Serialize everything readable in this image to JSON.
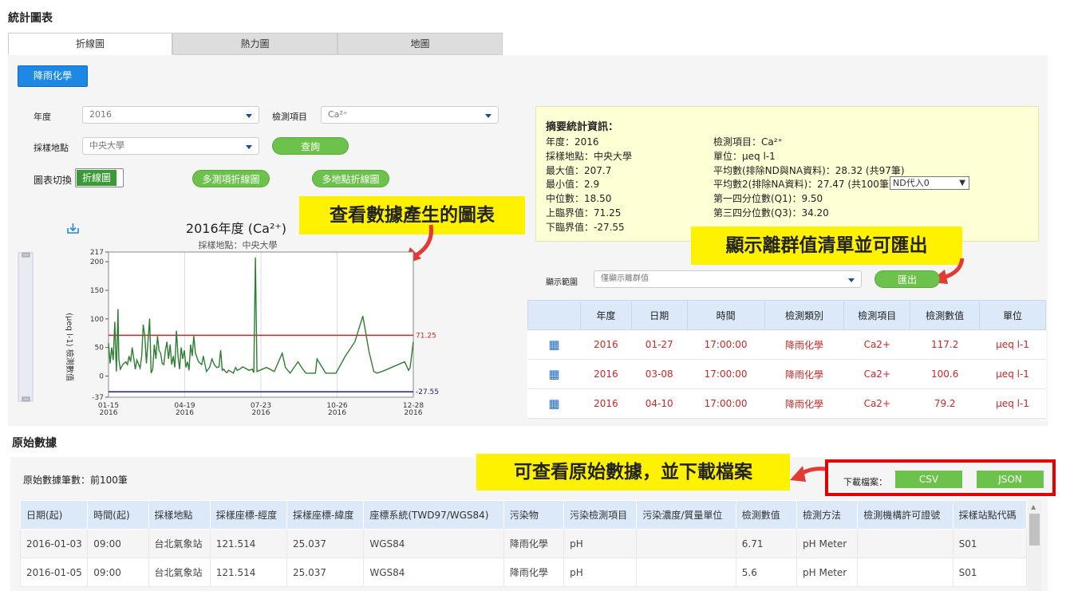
{
  "page_title": "統計圖表",
  "tabs": [
    "折線圖",
    "熱力圖",
    "地圖"
  ],
  "category_button": "降雨化學",
  "filters": {
    "year_label": "年度",
    "year_value": "2016",
    "item_label": "檢測項目",
    "item_value": "Ca²⁺",
    "site_label": "採樣地點",
    "site_value": "中央大學",
    "query_button": "查詢",
    "switch_label": "圖表切換",
    "switch_value": "折線圖",
    "multi_item_button": "多測項折線圖",
    "multi_site_button": "多地點折線圖"
  },
  "callouts": {
    "chart": "查看數據產生的圖表",
    "outlier": "顯示離群值清單並可匯出",
    "raw": "可查看原始數據，並下載檔案"
  },
  "chart_data": {
    "type": "line",
    "title": "2016年度 (Ca²⁺)",
    "subtitle": "採樣地點：中央大學",
    "ylabel": "(μeq l-1) 檢測數值",
    "ylim": [
      -37,
      217
    ],
    "yticks": [
      "217",
      "200",
      "150",
      "100",
      "50",
      "0",
      "-37"
    ],
    "xticks": [
      {
        "d": "01-15",
        "y": "2016"
      },
      {
        "d": "04-19",
        "y": "2016"
      },
      {
        "d": "07-23",
        "y": "2016"
      },
      {
        "d": "10-26",
        "y": "2016"
      },
      {
        "d": "12-28",
        "y": "2016"
      }
    ],
    "upper_bound": 71.25,
    "lower_bound": -27.55,
    "upper_label": "71.25",
    "lower_label": "-27.55",
    "series": [
      {
        "values": [
          [
            0,
            58
          ],
          [
            2,
            22
          ],
          [
            4,
            50
          ],
          [
            6,
            28
          ],
          [
            8,
            95
          ],
          [
            9,
            45
          ],
          [
            10,
            8
          ],
          [
            12,
            117.2
          ],
          [
            13,
            30
          ],
          [
            15,
            12
          ],
          [
            18,
            20
          ],
          [
            22,
            25
          ],
          [
            24,
            20
          ],
          [
            26,
            35
          ],
          [
            28,
            25
          ],
          [
            30,
            50
          ],
          [
            34,
            12
          ],
          [
            36,
            28
          ],
          [
            40,
            14
          ],
          [
            42,
            35
          ],
          [
            44,
            90
          ],
          [
            46,
            70
          ],
          [
            48,
            22
          ],
          [
            52,
            100.6
          ],
          [
            54,
            5
          ],
          [
            56,
            12
          ],
          [
            58,
            55
          ],
          [
            60,
            30
          ],
          [
            62,
            70
          ],
          [
            64,
            45
          ],
          [
            66,
            40
          ],
          [
            68,
            22
          ],
          [
            70,
            20
          ],
          [
            72,
            45
          ],
          [
            74,
            60
          ],
          [
            76,
            30
          ],
          [
            78,
            55
          ],
          [
            80,
            20
          ],
          [
            82,
            35
          ],
          [
            84,
            15
          ],
          [
            86,
            79.2
          ],
          [
            88,
            35
          ],
          [
            90,
            12
          ],
          [
            92,
            50
          ],
          [
            94,
            30
          ],
          [
            96,
            45
          ],
          [
            98,
            15
          ],
          [
            100,
            25
          ],
          [
            102,
            10
          ],
          [
            104,
            55
          ],
          [
            106,
            35
          ],
          [
            108,
            70
          ],
          [
            110,
            40
          ],
          [
            114,
            25
          ],
          [
            118,
            20
          ],
          [
            120,
            35
          ],
          [
            124,
            8
          ],
          [
            128,
            15
          ],
          [
            131,
            30
          ],
          [
            134,
            20
          ],
          [
            137,
            15
          ],
          [
            140,
            16
          ],
          [
            142,
            45
          ],
          [
            143,
            30
          ],
          [
            144,
            10
          ],
          [
            146,
            12
          ],
          [
            148,
            8
          ],
          [
            150,
            6
          ],
          [
            152,
            10
          ],
          [
            155,
            8
          ],
          [
            158,
            5
          ],
          [
            161,
            15
          ],
          [
            163,
            10
          ],
          [
            166,
            12
          ],
          [
            170,
            16
          ],
          [
            178,
            10
          ],
          [
            182,
            12
          ],
          [
            184,
            6
          ],
          [
            186,
            207.7
          ],
          [
            188,
            8
          ],
          [
            200,
            15
          ],
          [
            210,
            8
          ],
          [
            220,
            40
          ],
          [
            224,
            15
          ],
          [
            230,
            5
          ],
          [
            240,
            25
          ],
          [
            246,
            12
          ],
          [
            250,
            5
          ],
          [
            262,
            5
          ],
          [
            264,
            30
          ],
          [
            275,
            5
          ],
          [
            288,
            5
          ],
          [
            300,
            35
          ],
          [
            312,
            60
          ],
          [
            322,
            105
          ],
          [
            330,
            42
          ],
          [
            336,
            8
          ],
          [
            340,
            5
          ],
          [
            350,
            10
          ],
          [
            370,
            22
          ],
          [
            375,
            25
          ],
          [
            380,
            10
          ],
          [
            382,
            15
          ],
          [
            386,
            60
          ]
        ]
      }
    ],
    "x_range": [
      0,
      386
    ]
  },
  "summary": {
    "title": "摘要統計資訊：",
    "left": [
      "年度：2016",
      "採樣地點：中央大學",
      "最大值：207.7",
      "最小值：2.9",
      "中位數：18.50",
      "上臨界值：71.25",
      "下臨界值：-27.55"
    ],
    "right": [
      "檢測項目：Ca²⁺",
      "單位：μeq l-1",
      "平均數(排除ND與NA資料)：28.32 (共97筆)",
      "平均數2(排除NA資料)：27.47 (共100筆)",
      "第一四分位數(Q1)：9.50",
      "第三四分位數(Q3)：34.20"
    ],
    "nd_select": "ND代入0"
  },
  "outlier": {
    "range_label": "顯示範圍",
    "range_value": "僅顯示離群值",
    "export_button": "匯出",
    "headers": [
      "",
      "年度",
      "日期",
      "時間",
      "檢測類別",
      "檢測項目",
      "檢測數值",
      "單位"
    ],
    "rows": [
      [
        "2016",
        "01-27",
        "17:00:00",
        "降雨化學",
        "Ca2+",
        "117.2",
        "μeq l-1"
      ],
      [
        "2016",
        "03-08",
        "17:00:00",
        "降雨化學",
        "Ca2+",
        "100.6",
        "μeq l-1"
      ],
      [
        "2016",
        "04-10",
        "17:00:00",
        "降雨化學",
        "Ca2+",
        "79.2",
        "μeq l-1"
      ]
    ]
  },
  "raw": {
    "section_title": "原始數據",
    "count_label": "原始數據筆數：前100筆",
    "download_label": "下載檔案：",
    "csv_button": "CSV",
    "json_button": "JSON",
    "headers": [
      "日期(起)",
      "時間(起)",
      "採樣地點",
      "採樣座標-經度",
      "採樣座標-緯度",
      "座標系統(TWD97/WGS84)",
      "污染物",
      "污染檢測項目",
      "污染濃度/質量單位",
      "檢測數值",
      "檢測方法",
      "檢測機構許可證號",
      "採樣站點代碼"
    ],
    "rows": [
      [
        "2016-01-03",
        "09:00",
        "台北氣象站",
        "121.514",
        "25.037",
        "WGS84",
        "降雨化學",
        "pH",
        "",
        "6.71",
        "pH Meter",
        "",
        "S01"
      ],
      [
        "2016-01-05",
        "09:00",
        "台北氣象站",
        "121.514",
        "25.037",
        "WGS84",
        "降雨化學",
        "pH",
        "",
        "5.6",
        "pH Meter",
        "",
        "S01"
      ]
    ]
  },
  "colors": {
    "upper": "#c62828",
    "lower": "#1a237e",
    "series": "#2e7d32"
  }
}
